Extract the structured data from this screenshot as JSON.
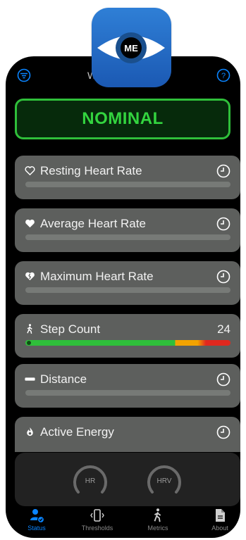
{
  "app_icon": {
    "text": "ME",
    "name": "eye-icon"
  },
  "topbar": {
    "title_fragment": "W"
  },
  "status": {
    "label": "NOMINAL",
    "color": "#33d43f"
  },
  "cards": [
    {
      "label": "Resting Heart Rate",
      "icon": "heart-outline-icon",
      "history": true
    },
    {
      "label": "Average Heart Rate",
      "icon": "heart-filled-icon",
      "history": true
    },
    {
      "label": "Maximum Heart Rate",
      "icon": "heart-broken-icon",
      "history": true
    },
    {
      "label": "Step Count",
      "icon": "walk-icon",
      "value": "24"
    },
    {
      "label": "Distance",
      "icon": "distance-icon",
      "history": true
    },
    {
      "label": "Active Energy",
      "icon": "flame-icon",
      "history": true
    }
  ],
  "gauges": [
    {
      "label": "HR"
    },
    {
      "label": "HRV"
    }
  ],
  "tabs": [
    {
      "label": "Status",
      "icon": "person-badge-icon",
      "active": true
    },
    {
      "label": "Thresholds",
      "icon": "vibration-icon",
      "active": false
    },
    {
      "label": "Metrics",
      "icon": "walk-icon",
      "active": false
    },
    {
      "label": "About",
      "icon": "document-icon",
      "active": false
    }
  ],
  "colors": {
    "accent": "#0a84ff",
    "good": "#2fbf3a",
    "warn": "#f2a300",
    "bad": "#e0281f",
    "inactive_tab": "#8a8a8a"
  }
}
